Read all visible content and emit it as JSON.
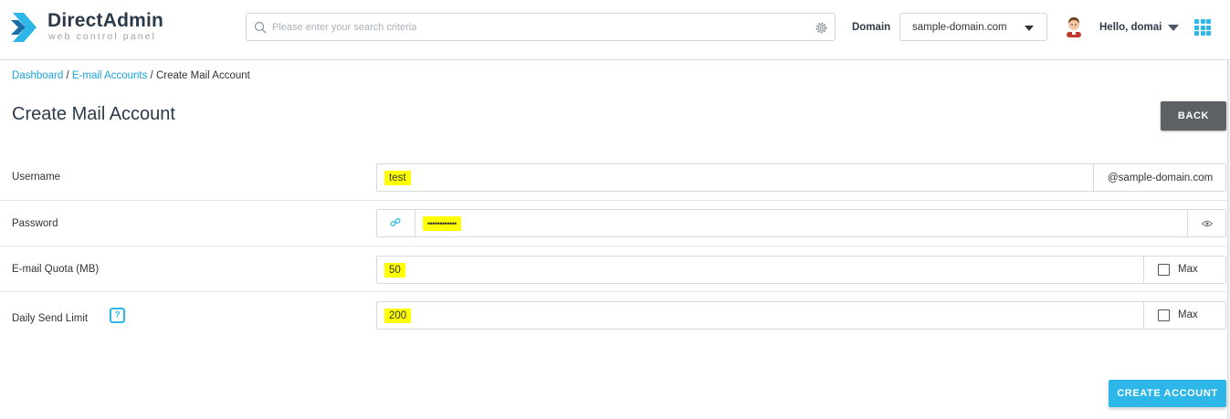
{
  "header": {
    "brand_name": "DirectAdmin",
    "brand_subtitle": "web control panel",
    "search_placeholder": "Please enter your search criteria",
    "domain_label": "Domain",
    "domain_value": "sample-domain.com",
    "user_greeting": "Hello, domai"
  },
  "breadcrumb": {
    "items": [
      "Dashboard",
      "E-mail Accounts",
      "Create Mail Account"
    ],
    "separator": "/"
  },
  "page": {
    "title": "Create Mail Account",
    "back_label": "BACK",
    "create_label": "CREATE ACCOUNT"
  },
  "form": {
    "username": {
      "label": "Username",
      "value": "test",
      "domain_suffix": "@sample-domain.com"
    },
    "password": {
      "label": "Password",
      "value": "••••••••••••"
    },
    "quota": {
      "label": "E-mail Quota (MB)",
      "value": "50",
      "max_label": "Max"
    },
    "send_limit": {
      "label": "Daily Send Limit",
      "value": "200",
      "max_label": "Max",
      "help": "?"
    }
  },
  "colors": {
    "accent": "#2db7e8",
    "brand_text": "#2d3a4a",
    "back_button": "#5d6166",
    "highlight": "#ffff00"
  },
  "icons": {
    "logo": "directadmin-chevron-logo",
    "search": "search-icon",
    "settings": "gear-icon",
    "avatar": "user-avatar",
    "apps": "grid-icon",
    "password_generate": "link-icon",
    "password_toggle": "eye-icon"
  }
}
